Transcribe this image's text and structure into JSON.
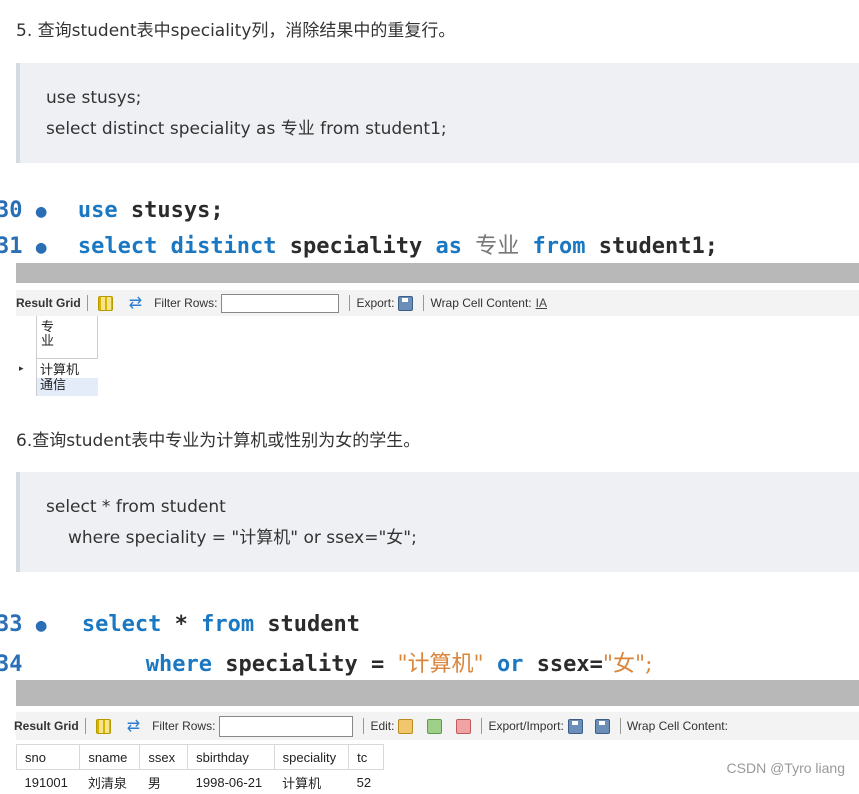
{
  "section5": {
    "question": "5. 查询student表中speciality列，消除结果中的重复行。",
    "code_lines": [
      "use stusys;",
      "select distinct speciality as 专业 from student1;"
    ],
    "editor": {
      "line1": {
        "num": "30",
        "kw1": "use",
        "rest": "stusys;"
      },
      "line2": {
        "num": "31",
        "kw1": "select",
        "kw2": "distinct",
        "ident": "speciality",
        "kw3": "as",
        "alias": "专业",
        "kw4": "from",
        "table": "student1;"
      }
    },
    "toolbar": {
      "result_grid": "Result Grid",
      "filter_rows": "Filter Rows:",
      "filter_value": "",
      "export": "Export:",
      "wrap": "Wrap Cell Content:",
      "wrap_icon": "IA"
    },
    "grid": {
      "header": "专\n业",
      "row_marker": "▸",
      "rows": [
        "计算机",
        "通信"
      ]
    }
  },
  "section6": {
    "question": "6.查询student表中专业为计算机或性别为女的学生。",
    "code_lines": [
      "select * from student",
      "where speciality = \"计算机\" or ssex=\"女\";"
    ],
    "editor": {
      "line1": {
        "num": "33",
        "kw1": "select",
        "star": "*",
        "kw2": "from",
        "table": "student"
      },
      "line2": {
        "num": "34",
        "kw1": "where",
        "ident": "speciality",
        "eq": "=",
        "str1": "\"计算机\"",
        "kw2": "or",
        "ident2": "ssex=",
        "str2": "\"女\";"
      }
    },
    "toolbar": {
      "result_grid": "Result Grid",
      "filter_rows": "Filter Rows:",
      "filter_value": "",
      "edit": "Edit:",
      "export_import": "Export/Import:",
      "wrap": "Wrap Cell Content:"
    },
    "grid": {
      "columns": [
        "sno",
        "sname",
        "ssex",
        "sbirthday",
        "speciality",
        "tc"
      ],
      "rows": [
        [
          "191001",
          "刘清泉",
          "男",
          "1998-06-21",
          "计算机",
          "52"
        ]
      ]
    }
  },
  "watermark": "CSDN @Tyro liang"
}
